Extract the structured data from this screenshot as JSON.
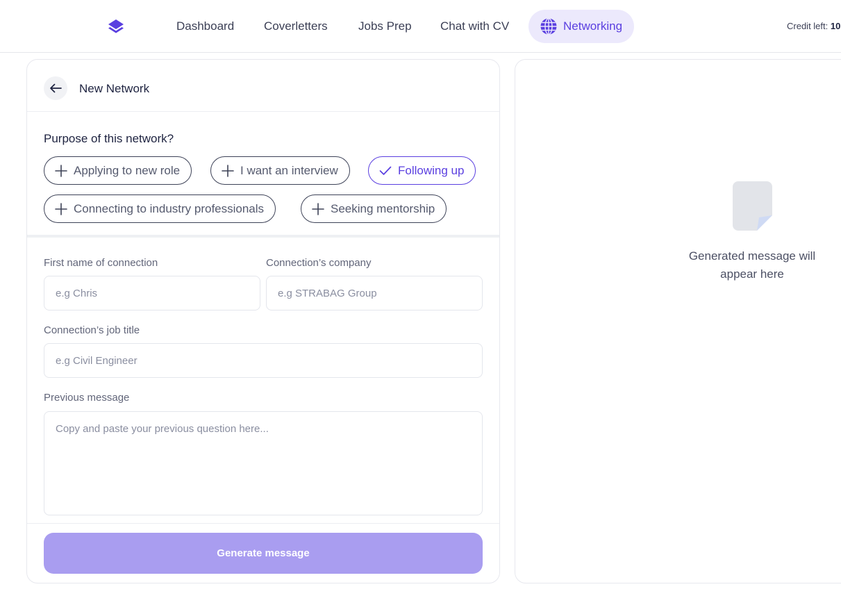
{
  "nav": {
    "items": [
      {
        "label": "Dashboard"
      },
      {
        "label": "Coverletters"
      },
      {
        "label": "Jobs Prep"
      },
      {
        "label": "Chat with CV"
      },
      {
        "label": "Networking",
        "active": true
      }
    ],
    "credit_label": "Credit left:",
    "credit_value": "10"
  },
  "form": {
    "back_icon": "arrow-left-icon",
    "title": "New Network",
    "purpose_label": "Purpose of this network?",
    "purposes": [
      {
        "label": "Applying to new role",
        "selected": false
      },
      {
        "label": "I want an interview",
        "selected": false
      },
      {
        "label": "Following up",
        "selected": true
      },
      {
        "label": "Connecting to industry professionals",
        "selected": false
      },
      {
        "label": "Seeking mentorship",
        "selected": false
      }
    ],
    "fields": {
      "first_name": {
        "label": "First name of connection",
        "placeholder": "e.g Chris",
        "value": ""
      },
      "company": {
        "label": "Connection’s company",
        "placeholder": "e.g STRABAG Group",
        "value": ""
      },
      "job_title": {
        "label": "Connection’s job title",
        "placeholder": "e.g Civil Engineer",
        "value": ""
      },
      "previous_message": {
        "label": "Previous message",
        "placeholder": "Copy and paste your previous question here...",
        "value": ""
      }
    },
    "submit_label": "Generate message"
  },
  "preview": {
    "icon": "document-icon",
    "placeholder": "Generated message will appear here"
  },
  "colors": {
    "accent": "#5a3fe0",
    "accent_bg": "#ece9fc",
    "button_disabled": "#a99df0",
    "text": "#1e2340"
  }
}
